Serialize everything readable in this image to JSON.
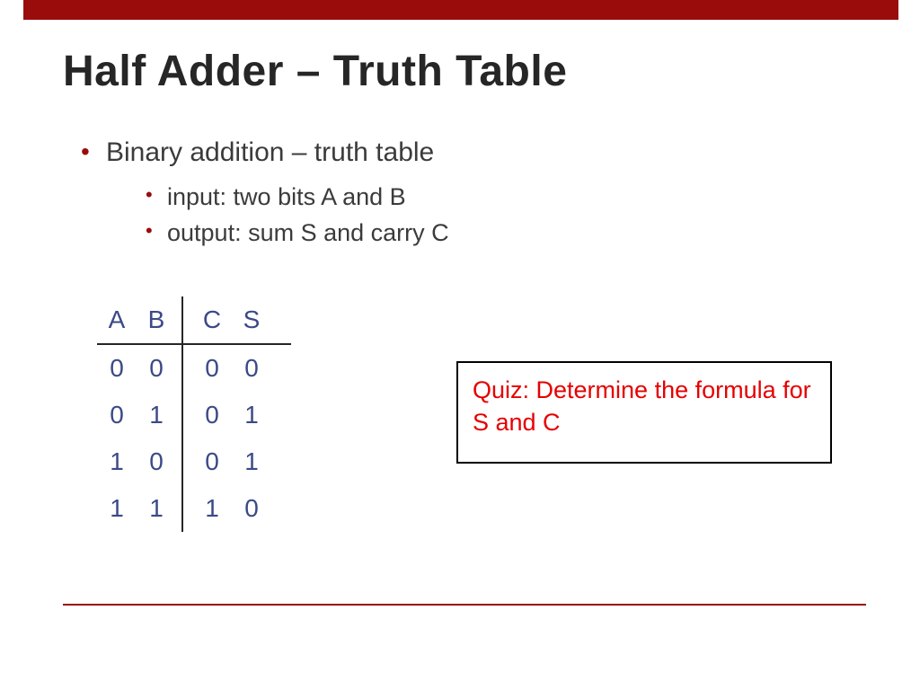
{
  "title": "Half Adder – Truth Table",
  "bullets": {
    "b1": "Binary addition – truth table",
    "b1_1": "input: two bits A and B",
    "b1_2": "output: sum S and carry C"
  },
  "table": {
    "headers": {
      "h0": "A",
      "h1": "B",
      "h2": "C",
      "h3": "S"
    },
    "rows": [
      {
        "a": "0",
        "b": "0",
        "c": "0",
        "s": "0"
      },
      {
        "a": "0",
        "b": "1",
        "c": "0",
        "s": "1"
      },
      {
        "a": "1",
        "b": "0",
        "c": "0",
        "s": "1"
      },
      {
        "a": "1",
        "b": "1",
        "c": "1",
        "s": "0"
      }
    ]
  },
  "quiz": "Quiz: Determine the formula for S and C",
  "colors": {
    "accent": "#9a0c0c",
    "table_text": "#3b4a87",
    "quiz_text": "#e60000"
  },
  "chart_data": {
    "type": "table",
    "title": "Half Adder Truth Table",
    "columns": [
      "A",
      "B",
      "C",
      "S"
    ],
    "rows": [
      [
        0,
        0,
        0,
        0
      ],
      [
        0,
        1,
        0,
        1
      ],
      [
        1,
        0,
        0,
        1
      ],
      [
        1,
        1,
        1,
        0
      ]
    ]
  }
}
